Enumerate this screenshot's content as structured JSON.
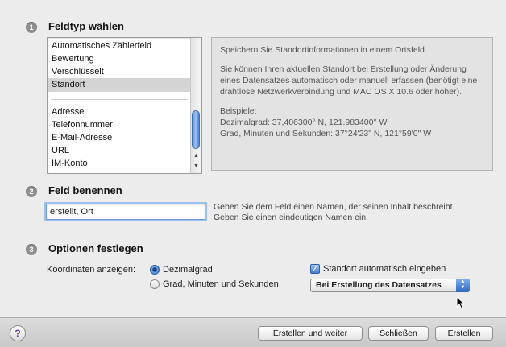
{
  "sections": {
    "choose_type": {
      "number": "1",
      "title": "Feldtyp wählen"
    },
    "name_field": {
      "number": "2",
      "title": "Feld benennen"
    },
    "options": {
      "number": "3",
      "title": "Optionen festlegen"
    }
  },
  "field_types": {
    "items_top": [
      "Automatisches Zählerfeld",
      "Bewertung",
      "Verschlüsselt",
      "Standort"
    ],
    "selected": "Standort",
    "items_bottom": [
      "Adresse",
      "Telefonnummer",
      "E-Mail-Adresse",
      "URL",
      "IM-Konto"
    ]
  },
  "description": {
    "p1": "Speichern Sie Standortinformationen in einem Ortsfeld.",
    "p2": "Sie können Ihren aktuellen Standort bei Erstellung oder Änderung eines Datensatzes automatisch oder manuell erfassen (benötigt eine drahtlose Netzwerkverbindung und MAC OS X 10.6 oder höher).",
    "p3_title": "Beispiele:",
    "p3_line1": "Dezimalgrad: 37,406300° N, 121.983400° W",
    "p3_line2": "Grad, Minuten und Sekunden: 37°24'23\" N, 121°59'0\" W"
  },
  "name_input": {
    "value": "erstellt, Ort",
    "hint": "Geben Sie dem Feld einen Namen, der seinen Inhalt beschreibt. Geben Sie einen eindeutigen Namen ein."
  },
  "options": {
    "coords_label": "Koordinaten anzeigen:",
    "radio_decimal": "Dezimalgrad",
    "radio_dms": "Grad, Minuten und Sekunden",
    "selected_radio": "Dezimalgrad",
    "auto_checkbox": "Standort automatisch eingeben",
    "auto_checked": true,
    "popup_value": "Bei Erstellung des Datensatzes"
  },
  "buttons": {
    "help": "?",
    "create_continue": "Erstellen und weiter",
    "close": "Schließen",
    "create": "Erstellen"
  },
  "colors": {
    "accent": "#3c73c8",
    "selection": "#d4d4d4"
  }
}
